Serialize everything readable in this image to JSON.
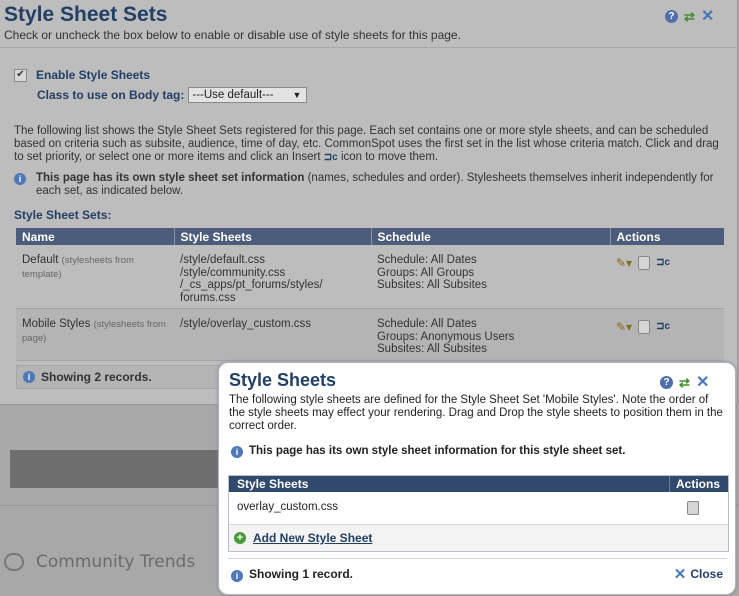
{
  "background": {
    "trends_label": "Community Trends"
  },
  "outer_dialog": {
    "title": "Style Sheet Sets",
    "subtitle": "Check or uncheck the box below to enable or disable use of style sheets for this page.",
    "enable_label": "Enable Style Sheets",
    "enable_checked": true,
    "class_label": "Class to use on Body tag:",
    "class_select_value": "---Use default---",
    "description_part1": "The following list shows the Style Sheet Sets registered for this page. Each set contains one or more style sheets, and can be scheduled based on criteria such as subsite, audience, time of day, etc. CommonSpot uses the first set in the list whose criteria match. Click and drag to set priority, or select one or more items and click an Insert",
    "description_part2": "icon to move them.",
    "info_bold": "This page has its own style sheet set information",
    "info_rest": " (names, schedules and order). Stylesheets themselves inherit independently for each set, as indicated below.",
    "sets_label": "Style Sheet Sets:",
    "columns": [
      "Name",
      "Style Sheets",
      "Schedule",
      "Actions"
    ],
    "rows": [
      {
        "name": "Default",
        "name_note": "(stylesheets from template)",
        "sheets": [
          "/style/default.css",
          "/style/community.css",
          "/_cs_apps/pt_forums/styles/",
          "forums.css"
        ],
        "schedule": [
          "Schedule: All Dates",
          "Groups: All Groups",
          "Subsites: All Subsites"
        ]
      },
      {
        "name": "Mobile Styles",
        "name_note": "(stylesheets from page)",
        "sheets": [
          "/style/overlay_custom.css"
        ],
        "schedule": [
          "Schedule: All Dates",
          "Groups: Anonymous Users",
          "Subsites: All Subsites"
        ]
      }
    ],
    "records": "Showing 2 records."
  },
  "inner_dialog": {
    "title": "Style Sheets",
    "description": "The following style sheets are defined for the Style Sheet Set 'Mobile Styles'. Note the order of the style sheets may effect your rendering. Drag and Drop the style sheets to position them in the correct order.",
    "info": "This page has its own style sheet information for this style sheet set.",
    "columns": [
      "Style Sheets",
      "Actions"
    ],
    "rows": [
      {
        "sheet": "overlay_custom.css"
      }
    ],
    "add_link": "Add New Style Sheet",
    "records": "Showing 1 record.",
    "close_label": "Close"
  },
  "icons": {
    "help": "help-icon",
    "refresh": "refresh-icon",
    "close": "close-icon",
    "info": "info-icon",
    "edit": "pencil-icon",
    "lock": "lock-icon",
    "insert": "insert-icon",
    "add": "plus-icon"
  }
}
